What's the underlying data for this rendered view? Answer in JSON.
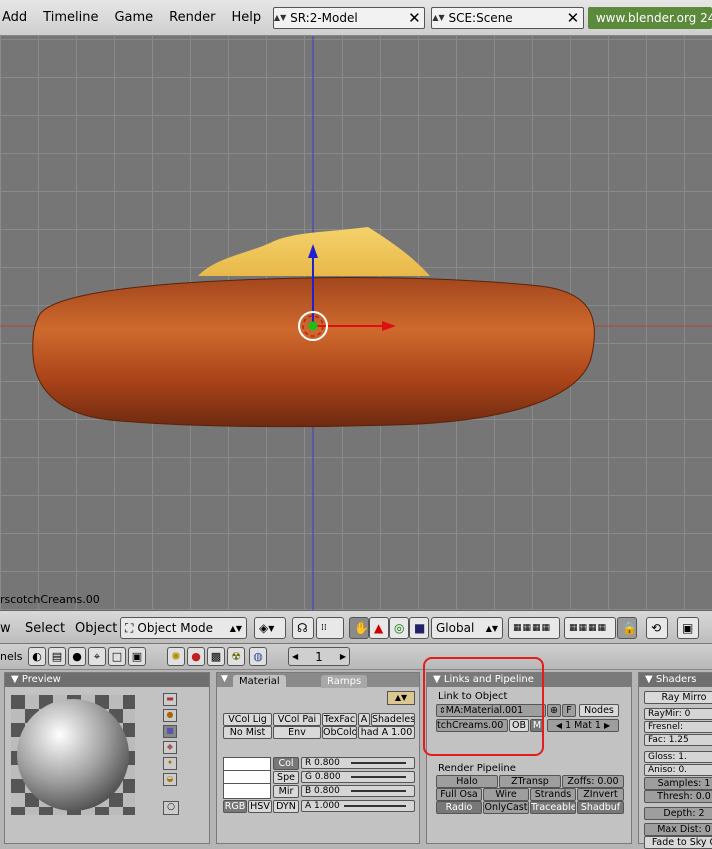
{
  "menu": [
    "Add",
    "Timeline",
    "Game",
    "Render",
    "Help"
  ],
  "screen_field": "SR:2-Model",
  "scene_field": "SCE:Scene",
  "website": "www.blender.org 24",
  "object_name_label": "rscotchCreams.00",
  "header3d": {
    "view_partial": "w",
    "select": "Select",
    "object": "Object",
    "mode": "Object Mode",
    "orientation": "Global"
  },
  "buttons_header": {
    "left_partial": "nels",
    "frame": "1"
  },
  "preview_panel": {
    "title": "Preview"
  },
  "material_panel": {
    "tab_material": "Material",
    "tab_ramps": "Ramps",
    "row1": [
      "VCol Lig",
      "VCol Pai",
      "TexFac",
      "A",
      "Shadeles"
    ],
    "row2": [
      "No Mist",
      "Env",
      "ObColo",
      "had A 1.00"
    ],
    "col_buttons": [
      "Col",
      "Spe",
      "Mir"
    ],
    "r": "R 0.800",
    "g": "G 0.800",
    "b": "B 0.800",
    "a": "A 1.000",
    "modes": [
      "RGB",
      "HSV",
      "DYN"
    ]
  },
  "links_panel": {
    "title": "Links and Pipeline",
    "link_to_object": "Link to Object",
    "material_name": "MA:Material.001",
    "f": "F",
    "nodes": "Nodes",
    "object_name": "tchCreams.00",
    "ob": "OB",
    "m": "M",
    "mat_index": "1 Mat 1",
    "render_pipeline": "Render Pipeline",
    "pipeline_row1": [
      "Halo",
      "ZTransp",
      "Zoffs: 0.00"
    ],
    "pipeline_row2": [
      "Full Osa",
      "Wire",
      "Strands",
      "ZInvert"
    ],
    "pipeline_row3": [
      "Radio",
      "OnlyCast",
      "Traceable",
      "Shadbuf"
    ]
  },
  "shaders_panel": {
    "title": "Shaders",
    "ray_mirror": "Ray Mirro",
    "raymir": "RayMir: 0",
    "fresnel": "Fresnel:",
    "fac": "Fac: 1.25",
    "gloss": "Gloss: 1.",
    "aniso": "Aniso: 0.",
    "samples": "Samples: 1",
    "thresh": "Thresh: 0.0",
    "depth": "Depth: 2",
    "max_dist": "Max Dist: 0",
    "fade": "Fade to Sky C"
  },
  "colors": {
    "highlight": "#e31d1d",
    "web_bg": "#5a8a3a"
  }
}
